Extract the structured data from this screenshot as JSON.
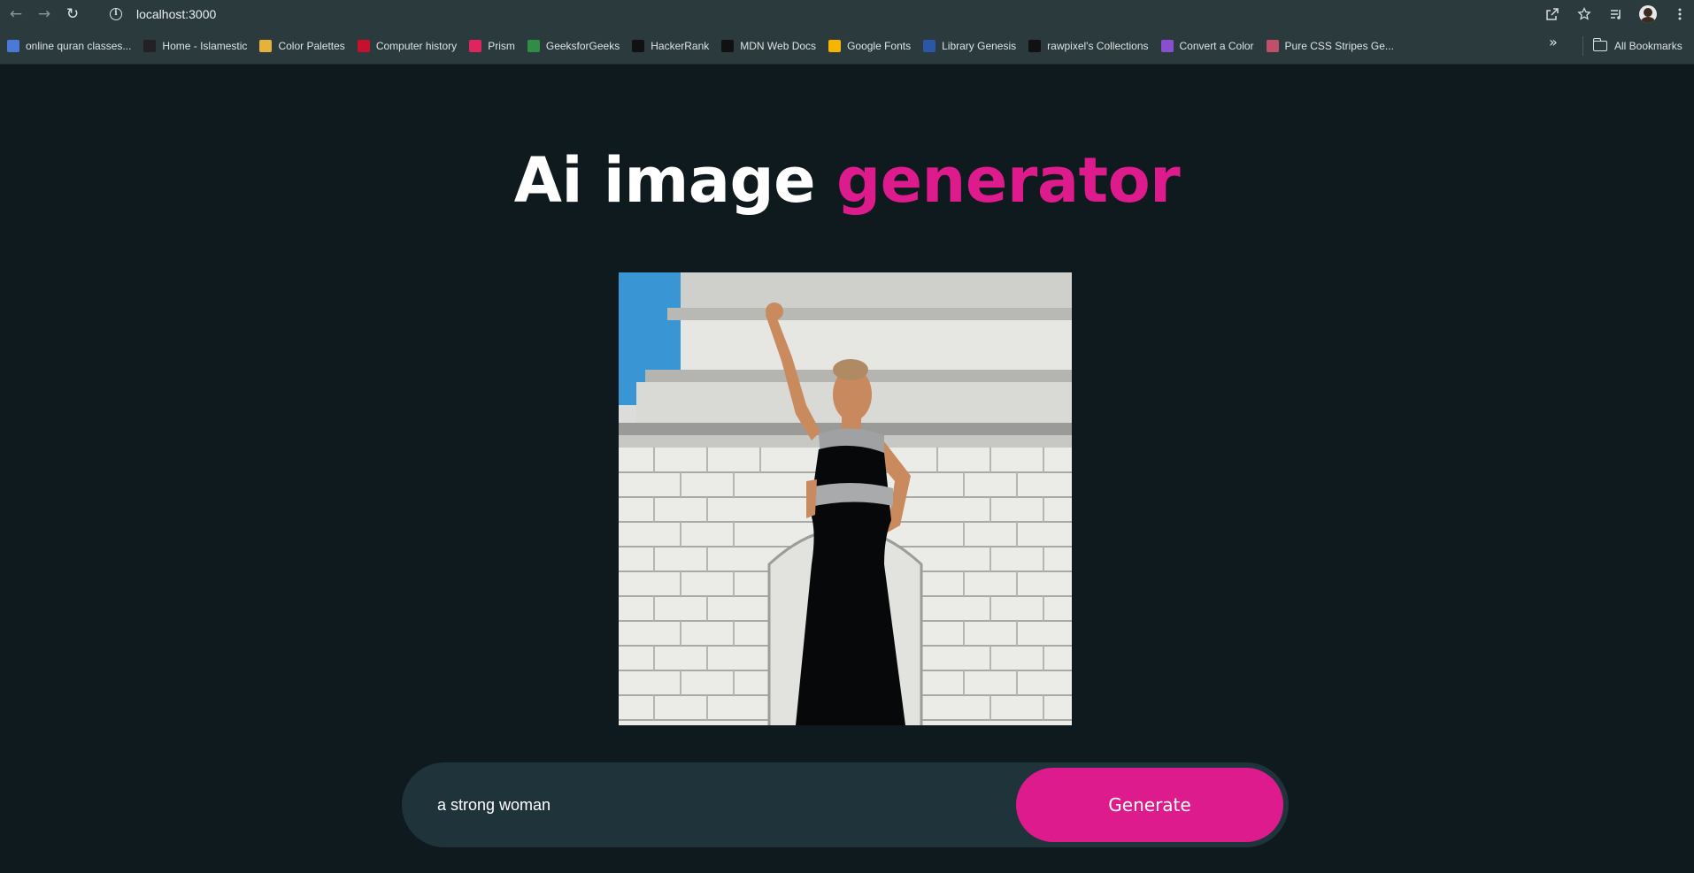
{
  "browser": {
    "url": "localhost:3000",
    "back_icon": "arrow-left-icon",
    "forward_icon": "arrow-right-icon",
    "reload_icon": "reload-icon",
    "bookmarks": [
      {
        "label": "online quran classes...",
        "icon": "globe-favicon",
        "color": "#4a7ad8"
      },
      {
        "label": "Home - Islamestic",
        "icon": "islamestic-favicon",
        "color": "#222222"
      },
      {
        "label": "Color Palettes",
        "icon": "palette-favicon",
        "color": "#e6b23a"
      },
      {
        "label": "Computer history",
        "icon": "c-favicon",
        "color": "#c8102e"
      },
      {
        "label": "Prism",
        "icon": "prism-favicon",
        "color": "#e0245e"
      },
      {
        "label": "GeeksforGeeks",
        "icon": "gfg-favicon",
        "color": "#2f8d46"
      },
      {
        "label": "HackerRank",
        "icon": "hackerrank-favicon",
        "color": "#111111"
      },
      {
        "label": "MDN Web Docs",
        "icon": "mdn-favicon",
        "color": "#111111"
      },
      {
        "label": "Google Fonts",
        "icon": "google-fonts-favicon",
        "color": "#f4b400"
      },
      {
        "label": "Library Genesis",
        "icon": "libgen-favicon",
        "color": "#2a57a8"
      },
      {
        "label": "rawpixel's Collections",
        "icon": "rawpixel-favicon",
        "color": "#111111"
      },
      {
        "label": "Convert a Color",
        "icon": "convert-favicon",
        "color": "#8a4fd0"
      },
      {
        "label": "Pure CSS Stripes Ge...",
        "icon": "stripes-favicon",
        "color": "#c0506a"
      }
    ],
    "all_bookmarks_label": "All Bookmarks"
  },
  "page": {
    "title_part1": "Ai image ",
    "title_part2": "generator",
    "accent_color": "#de1b8c",
    "prompt_value": "a strong woman",
    "generate_label": "Generate"
  }
}
